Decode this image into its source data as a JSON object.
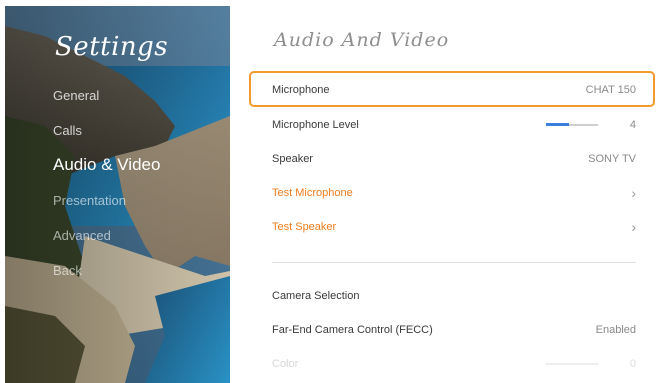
{
  "sidebar": {
    "title": "Settings",
    "items": [
      {
        "label": "General"
      },
      {
        "label": "Calls"
      },
      {
        "label": "Audio & Video"
      },
      {
        "label": "Presentation"
      },
      {
        "label": "Advanced"
      },
      {
        "label": "Back"
      }
    ]
  },
  "main": {
    "title": "Audio And Video",
    "rows": [
      {
        "label": "Microphone",
        "value": "CHAT 150"
      },
      {
        "label": "Microphone Level",
        "value": "4",
        "level": 0.45
      },
      {
        "label": "Speaker",
        "value": "SONY TV"
      },
      {
        "label": "Test Microphone"
      },
      {
        "label": "Test Speaker"
      },
      {
        "label": "Camera Selection"
      },
      {
        "label": "Far-End Camera Control (FECC)",
        "value": "Enabled"
      },
      {
        "label": "Color",
        "value": "0",
        "level": 0
      }
    ]
  },
  "colors": {
    "accent": "#f07c1e",
    "focus": "#f39a2c",
    "slider": "#3a7ee0"
  }
}
